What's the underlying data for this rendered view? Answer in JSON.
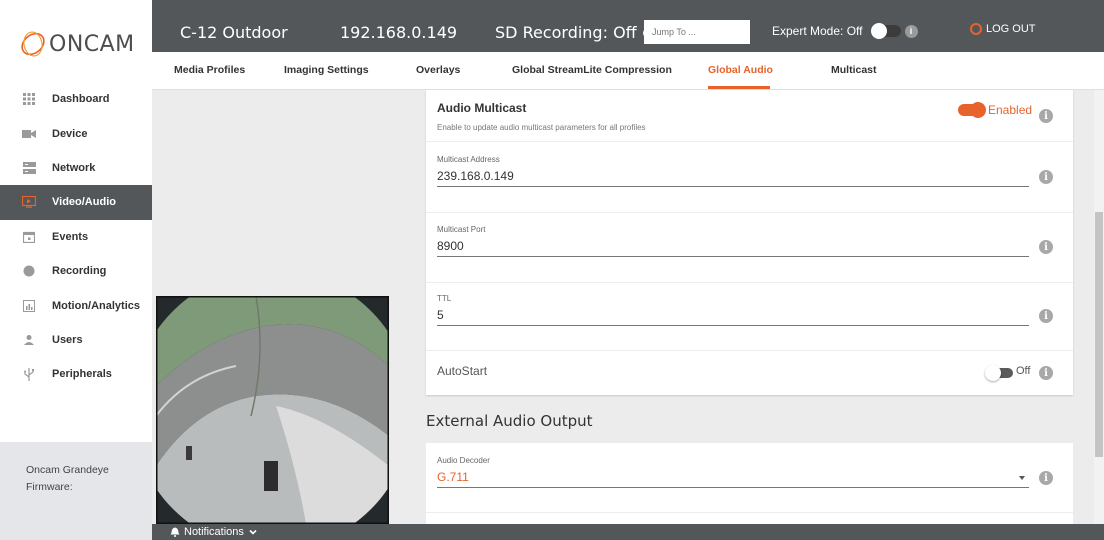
{
  "brand": {
    "logo_text": "ONCAM"
  },
  "header": {
    "model": "C-12 Outdoor",
    "ip": "192.168.0.149",
    "sd_recording": "SD Recording: Off",
    "jump_placeholder": "Jump To ...",
    "expert_mode": "Expert Mode: Off",
    "logout": "LOG OUT"
  },
  "tabs": [
    {
      "label": "Media Profiles"
    },
    {
      "label": "Imaging Settings"
    },
    {
      "label": "Overlays"
    },
    {
      "label": "Global StreamLite Compression"
    },
    {
      "label": "Global Audio"
    },
    {
      "label": "Multicast"
    }
  ],
  "active_tab": "Global Audio",
  "sidebar": {
    "items": [
      {
        "label": "Dashboard",
        "icon": "grid-icon"
      },
      {
        "label": "Device",
        "icon": "camera-icon"
      },
      {
        "label": "Network",
        "icon": "server-icon"
      },
      {
        "label": "Video/Audio",
        "icon": "video-icon",
        "active": true
      },
      {
        "label": "Events",
        "icon": "calendar-icon"
      },
      {
        "label": "Recording",
        "icon": "record-icon"
      },
      {
        "label": "Motion/Analytics",
        "icon": "chart-icon"
      },
      {
        "label": "Users",
        "icon": "user-icon"
      },
      {
        "label": "Peripherals",
        "icon": "usb-icon"
      }
    ],
    "footer_line1": "Oncam Grandeye",
    "footer_line2": "Firmware:"
  },
  "audio_multicast": {
    "title": "Audio Multicast",
    "description": "Enable to update audio multicast parameters for all profiles",
    "status": "Enabled",
    "address_label": "Multicast Address",
    "address_value": "239.168.0.149",
    "port_label": "Multicast Port",
    "port_value": "8900",
    "ttl_label": "TTL",
    "ttl_value": "5",
    "autostart_label": "AutoStart",
    "autostart_state": "Off"
  },
  "external_audio": {
    "title": "External Audio Output",
    "decoder_label": "Audio Decoder",
    "decoder_value": "G.711"
  },
  "notifications": {
    "label": "Notifications"
  },
  "colors": {
    "accent": "#e8632b",
    "header": "#53575a"
  }
}
